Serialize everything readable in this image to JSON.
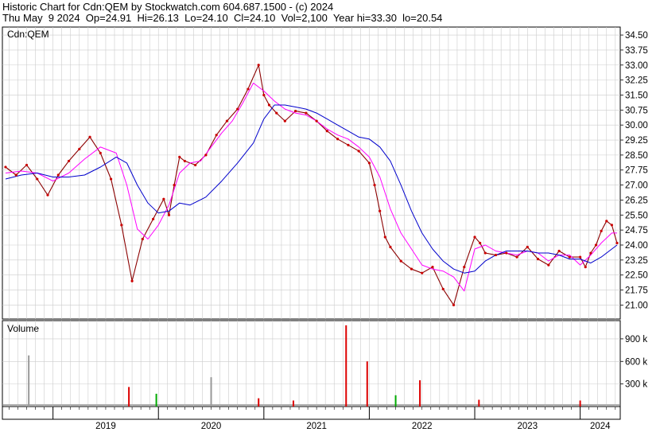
{
  "header": {
    "title": "Historic Chart for Cdn:QEM by Stockwatch.com 604.687.1500 - (c) 2024",
    "date": "Thu May  9 2024",
    "op": "Op=24.91",
    "hi": "Hi=26.13",
    "lo": "Lo=24.10",
    "cl": "Cl=24.10",
    "vol": "Vol=2,100",
    "year_hi": "Year hi=33.30",
    "year_lo": "lo=20.54"
  },
  "colors": {
    "price": "#8b0000",
    "dots": "#cc0000",
    "ma_short": "#ff00ff",
    "ma_long": "#0000cc",
    "vol_up": "#00aa00",
    "vol_down": "#dd0000",
    "vol_flat": "#999999",
    "grid": "#cccccc"
  },
  "chart_data": [
    {
      "type": "line",
      "panel_label": "Cdn:QEM",
      "ylim": [
        20.3,
        34.9
      ],
      "y_ticks": [
        "34.50",
        "33.75",
        "33.00",
        "32.25",
        "31.50",
        "30.75",
        "30.00",
        "29.25",
        "28.50",
        "27.75",
        "27.00",
        "26.25",
        "25.50",
        "24.75",
        "24.00",
        "23.25",
        "22.50",
        "21.75",
        "21.00"
      ],
      "x_years": [
        "2019",
        "2020",
        "2021",
        "2022",
        "2023",
        "2024"
      ],
      "series": [
        {
          "x": [
            2018.55,
            2018.65,
            2018.75,
            2018.85,
            2018.95,
            2019.05,
            2019.15,
            2019.25,
            2019.35,
            2019.45,
            2019.55,
            2019.65,
            2019.75,
            2019.85,
            2019.95,
            2020.05,
            2020.1,
            2020.15,
            2020.2,
            2020.25,
            2020.35,
            2020.45,
            2020.55,
            2020.65,
            2020.75,
            2020.85,
            2020.95,
            2021.0,
            2021.05,
            2021.12,
            2021.2,
            2021.3,
            2021.4,
            2021.5,
            2021.6,
            2021.7,
            2021.8,
            2021.9,
            2022.0,
            2022.05,
            2022.1,
            2022.15,
            2022.2,
            2022.3,
            2022.4,
            2022.5,
            2022.6,
            2022.7,
            2022.8,
            2022.9,
            2023.0,
            2023.05,
            2023.1,
            2023.2,
            2023.3,
            2023.4,
            2023.5,
            2023.6,
            2023.7,
            2023.8,
            2023.9,
            2024.0,
            2024.05,
            2024.1,
            2024.15,
            2024.2,
            2024.25,
            2024.3,
            2024.35
          ],
          "values": [
            27.9,
            27.5,
            28.0,
            27.3,
            26.5,
            27.5,
            28.2,
            28.8,
            29.4,
            28.6,
            27.3,
            25.0,
            22.2,
            24.3,
            25.3,
            26.3,
            25.5,
            27.0,
            28.4,
            28.2,
            28.0,
            28.5,
            29.5,
            30.2,
            30.8,
            31.8,
            33.0,
            31.5,
            31.0,
            30.6,
            30.2,
            30.7,
            30.6,
            30.2,
            29.7,
            29.3,
            29.0,
            28.7,
            28.1,
            27.0,
            25.7,
            24.4,
            23.9,
            23.2,
            22.8,
            22.6,
            22.9,
            21.8,
            21.0,
            22.9,
            24.4,
            24.1,
            23.6,
            23.5,
            23.6,
            23.4,
            23.9,
            23.3,
            23.0,
            23.7,
            23.4,
            23.4,
            22.9,
            23.6,
            24.0,
            24.7,
            25.2,
            25.0,
            24.1
          ]
        },
        {
          "x": [
            2018.55,
            2018.7,
            2018.85,
            2019.0,
            2019.15,
            2019.3,
            2019.45,
            2019.6,
            2019.7,
            2019.8,
            2019.9,
            2020.0,
            2020.1,
            2020.2,
            2020.3,
            2020.4,
            2020.5,
            2020.6,
            2020.7,
            2020.8,
            2020.9,
            2021.0,
            2021.1,
            2021.2,
            2021.3,
            2021.4,
            2021.5,
            2021.6,
            2021.7,
            2021.8,
            2021.9,
            2022.0,
            2022.1,
            2022.2,
            2022.3,
            2022.4,
            2022.5,
            2022.6,
            2022.7,
            2022.8,
            2022.9,
            2023.0,
            2023.1,
            2023.2,
            2023.3,
            2023.4,
            2023.5,
            2023.6,
            2023.7,
            2023.8,
            2023.9,
            2024.0,
            2024.1,
            2024.2,
            2024.3,
            2024.35
          ],
          "values": [
            27.6,
            27.7,
            27.6,
            27.2,
            27.6,
            28.3,
            28.9,
            28.6,
            27.0,
            24.8,
            24.3,
            25.0,
            26.0,
            27.6,
            28.1,
            28.2,
            28.9,
            29.6,
            30.2,
            31.1,
            32.1,
            31.7,
            31.2,
            30.8,
            30.6,
            30.5,
            30.2,
            29.8,
            29.5,
            29.3,
            28.9,
            28.4,
            27.4,
            25.8,
            24.6,
            23.8,
            23.0,
            22.8,
            22.7,
            22.4,
            21.7,
            23.8,
            24.0,
            23.7,
            23.6,
            23.5,
            23.7,
            23.6,
            23.2,
            23.5,
            23.5,
            23.0,
            23.5,
            24.1,
            24.6,
            24.6
          ]
        },
        {
          "x": [
            2018.55,
            2018.7,
            2018.85,
            2019.0,
            2019.15,
            2019.3,
            2019.45,
            2019.6,
            2019.7,
            2019.8,
            2019.9,
            2020.0,
            2020.1,
            2020.2,
            2020.3,
            2020.45,
            2020.6,
            2020.75,
            2020.9,
            2021.0,
            2021.1,
            2021.2,
            2021.3,
            2021.4,
            2021.5,
            2021.6,
            2021.7,
            2021.8,
            2021.9,
            2022.0,
            2022.1,
            2022.2,
            2022.3,
            2022.4,
            2022.5,
            2022.6,
            2022.7,
            2022.8,
            2022.9,
            2023.0,
            2023.1,
            2023.2,
            2023.3,
            2023.4,
            2023.5,
            2023.6,
            2023.7,
            2023.8,
            2023.9,
            2024.0,
            2024.1,
            2024.2,
            2024.3,
            2024.35
          ],
          "values": [
            27.3,
            27.5,
            27.6,
            27.4,
            27.4,
            27.5,
            27.9,
            28.4,
            28.1,
            27.0,
            26.1,
            25.6,
            25.7,
            26.1,
            26.0,
            26.4,
            27.2,
            28.1,
            29.1,
            30.3,
            31.0,
            31.0,
            30.9,
            30.8,
            30.6,
            30.3,
            30.0,
            29.7,
            29.4,
            29.3,
            28.9,
            28.2,
            27.0,
            25.7,
            24.6,
            23.8,
            23.2,
            22.8,
            22.6,
            22.7,
            23.2,
            23.5,
            23.7,
            23.7,
            23.7,
            23.6,
            23.6,
            23.5,
            23.3,
            23.3,
            23.1,
            23.4,
            23.8,
            24.0
          ]
        }
      ]
    },
    {
      "type": "bar",
      "panel_label": "Volume",
      "ylim": [
        0,
        1100000
      ],
      "y_ticks": [
        "900 k",
        "600 k",
        "300 k"
      ],
      "bars": [
        {
          "x": 2018.77,
          "value": 680000,
          "kind": "flat"
        },
        {
          "x": 2019.72,
          "value": 260000,
          "kind": "down"
        },
        {
          "x": 2019.98,
          "value": 170000,
          "kind": "up"
        },
        {
          "x": 2020.5,
          "value": 390000,
          "kind": "flat"
        },
        {
          "x": 2020.95,
          "value": 110000,
          "kind": "down"
        },
        {
          "x": 2021.28,
          "value": 80000,
          "kind": "down"
        },
        {
          "x": 2021.78,
          "value": 1080000,
          "kind": "down"
        },
        {
          "x": 2021.98,
          "value": 600000,
          "kind": "down"
        },
        {
          "x": 2022.25,
          "value": 150000,
          "kind": "up"
        },
        {
          "x": 2022.48,
          "value": 350000,
          "kind": "down"
        },
        {
          "x": 2023.04,
          "value": 90000,
          "kind": "down"
        },
        {
          "x": 2024.0,
          "value": 80000,
          "kind": "down"
        }
      ]
    }
  ]
}
